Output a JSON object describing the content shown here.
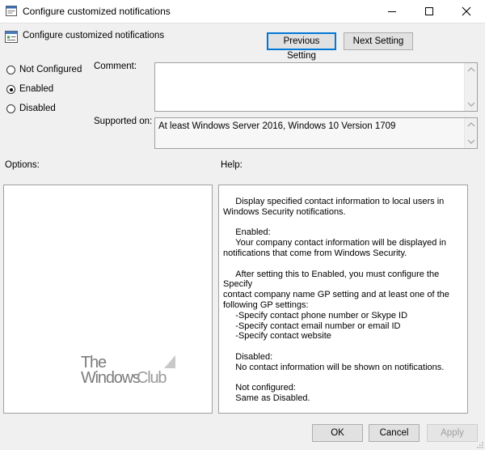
{
  "window": {
    "title": "Configure customized notifications",
    "minimize_icon": "minimize-icon",
    "maximize_icon": "maximize-icon",
    "close_icon": "close-icon"
  },
  "policy": {
    "name": "Configure customized notifications"
  },
  "nav": {
    "previous_label": "Previous Setting",
    "next_label": "Next Setting"
  },
  "state": {
    "options": [
      {
        "label": "Not Configured",
        "selected": false
      },
      {
        "label": "Enabled",
        "selected": true
      },
      {
        "label": "Disabled",
        "selected": false
      }
    ]
  },
  "comment": {
    "label": "Comment:",
    "value": ""
  },
  "supported": {
    "label": "Supported on:",
    "value": "At least Windows Server 2016, Windows 10 Version 1709"
  },
  "options_panel": {
    "label": "Options:"
  },
  "help_panel": {
    "label": "Help:",
    "text": "     Display specified contact information to local users in\nWindows Security notifications.\n\n     Enabled:\n     Your company contact information will be displayed in\nnotifications that come from Windows Security.\n\n     After setting this to Enabled, you must configure the Specify\ncontact company name GP setting and at least one of the\nfollowing GP settings:\n     -Specify contact phone number or Skype ID\n     -Specify contact email number or email ID\n     -Specify contact website\n\n     Disabled:\n     No contact information will be shown on notifications.\n\n     Not configured:\n     Same as Disabled."
  },
  "watermark": {
    "line1": "The",
    "line2": "Windows",
    "line3": "Club"
  },
  "footer": {
    "ok_label": "OK",
    "cancel_label": "Cancel",
    "apply_label": "Apply"
  },
  "colors": {
    "focus": "#0078d7",
    "dialog_bg": "#f0f0f0"
  }
}
